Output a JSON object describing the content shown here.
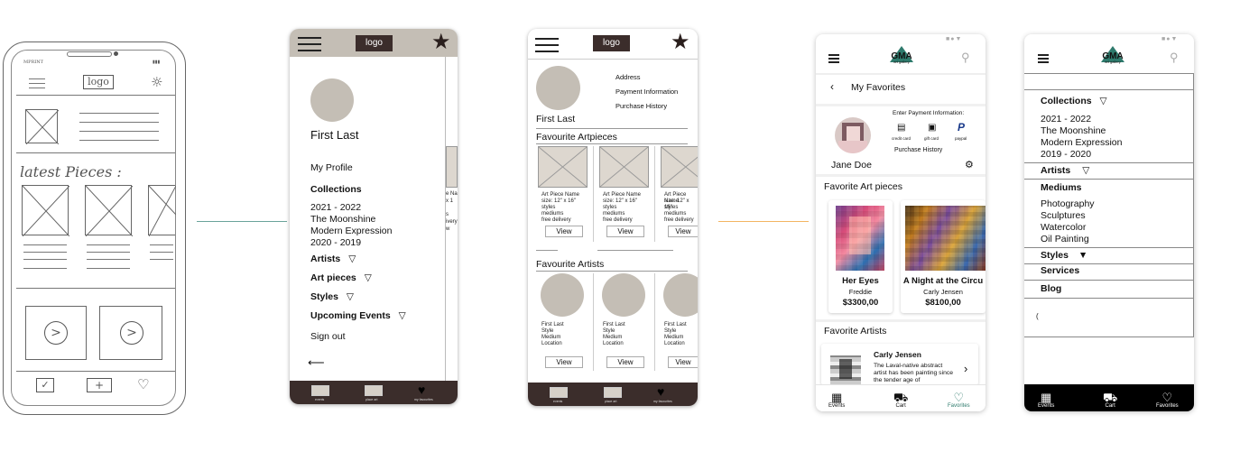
{
  "sketch": {
    "logo_label": "logo",
    "section_label": "latest Pieces :"
  },
  "wireframe_menu": {
    "logo_label": "logo",
    "profile_name": "First Last",
    "menu": {
      "my_profile": "My Profile",
      "collections": "Collections",
      "collection_items": [
        "2021 - 2022",
        "The Moonshine",
        "Modern Expression",
        "2020 - 2019"
      ],
      "artists": "Artists",
      "art_pieces": "Art pieces",
      "styles": "Styles",
      "upcoming_events": "Upcoming Events",
      "sign_out": "Sign out"
    },
    "peek_texts": [
      "e Na",
      "x 1",
      "s",
      "ivery",
      "w"
    ],
    "bottom_nav": [
      "events",
      "place art",
      "my favourites"
    ]
  },
  "wireframe_profile": {
    "logo_label": "logo",
    "profile_name": "First Last",
    "links": [
      "Address",
      "Payment Information",
      "Purchase History"
    ],
    "fav_artpieces_title": "Favourite Artpieces",
    "art_card_lines": [
      "Art Piece Name",
      "size: 12\" x 16\"",
      "styles",
      "mediums",
      "free delivery"
    ],
    "view_label": "View",
    "fav_artists_title": "Favourite Artists",
    "artist_card_lines": [
      "First Last",
      "Style",
      "Medium",
      "Location"
    ],
    "bottom_nav": [
      "events",
      "place art",
      "my favourites"
    ]
  },
  "hifi_favorites": {
    "brand": "GMA",
    "brand_sub": "art gallery",
    "page_title": "My Favorites",
    "user_name": "Jane Doe",
    "payment_title": "Enter Payment Information:",
    "payment_options": [
      "credit card",
      "gift card",
      "paypal"
    ],
    "purchase_history": "Purchase History",
    "fav_art_title": "Favorite Art pieces",
    "art_pieces": [
      {
        "title": "Her Eyes",
        "artist": "Freddie",
        "price": "$3300,00"
      },
      {
        "title": "A Night at the Circu",
        "artist": "Carly Jensen",
        "price": "$8100,00"
      }
    ],
    "fav_artists_title": "Favorite Artists",
    "artist": {
      "name": "Carly Jensen",
      "bio": "The Laval-native abstract artist has been painting since the tender age of"
    },
    "nav": [
      "Events",
      "Cart",
      "Favorites"
    ],
    "accent": "#2e7a6c"
  },
  "hifi_menu": {
    "brand": "GMA",
    "brand_sub": "art gallery",
    "collections": "Collections",
    "collection_items": [
      "2021 - 2022",
      "The Moonshine",
      "Modern Expression",
      "2019 - 2020"
    ],
    "artists": "Artists",
    "mediums": "Mediums",
    "medium_items": [
      "Photography",
      "Sculptures",
      "Watercolor",
      "Oil Painting"
    ],
    "styles": "Styles",
    "services": "Services",
    "blog": "Blog",
    "nav": [
      "Events",
      "Cart",
      "Favorites"
    ]
  }
}
